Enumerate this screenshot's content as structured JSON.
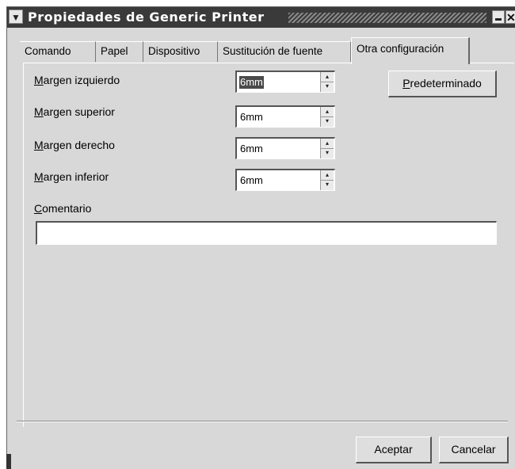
{
  "window": {
    "title": "Propiedades de Generic Printer",
    "menu_glyph": "▼",
    "close_glyph": "✕"
  },
  "tabs": [
    {
      "label": "Comando",
      "active": false
    },
    {
      "label": "Papel",
      "active": false
    },
    {
      "label": "Dispositivo",
      "active": false
    },
    {
      "label": "Sustitución de fuente",
      "active": false
    },
    {
      "label": "Otra configuración",
      "active": true
    }
  ],
  "fields": {
    "left_margin": {
      "mnemonic": "M",
      "rest": "argen izquierdo",
      "value": "6mm",
      "selected": true
    },
    "top_margin": {
      "mnemonic": "M",
      "rest": "argen superior",
      "value": "6mm",
      "selected": false
    },
    "right_margin": {
      "mnemonic": "M",
      "rest": "argen derecho",
      "value": "6mm",
      "selected": false
    },
    "bottom_margin": {
      "mnemonic": "M",
      "rest": "argen inferior",
      "value": "6mm",
      "selected": false
    },
    "comment": {
      "mnemonic": "C",
      "rest": "omentario",
      "value": ""
    }
  },
  "buttons": {
    "default": {
      "mnemonic": "P",
      "rest": "redeterminado"
    },
    "accept": "Aceptar",
    "cancel": "Cancelar"
  },
  "spin_arrows": {
    "up": "▴",
    "down": "▾"
  }
}
